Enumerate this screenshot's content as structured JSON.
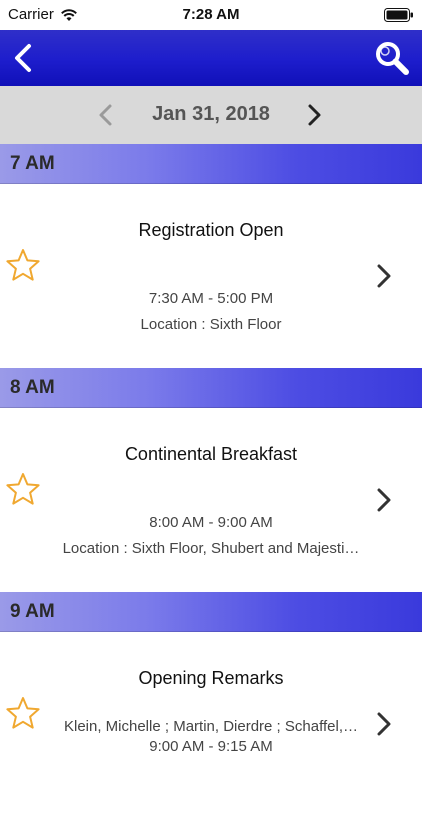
{
  "status_bar": {
    "carrier": "Carrier",
    "time": "7:28 AM",
    "wifi_icon": "wifi-icon",
    "battery_icon": "battery-icon"
  },
  "nav": {
    "back_icon": "chevron-left-icon",
    "search_icon": "search-icon",
    "bar_color": "#1d1dcc"
  },
  "date_bar": {
    "date": "Jan 31, 2018",
    "prev_icon": "chevron-left-icon",
    "next_icon": "chevron-right-icon"
  },
  "schedule": [
    {
      "hour": "7 AM",
      "session": {
        "title": "Registration Open",
        "speakers": "",
        "time": "7:30 AM - 5:00 PM",
        "location": "Location : Sixth Floor"
      }
    },
    {
      "hour": "8 AM",
      "session": {
        "title": "Continental Breakfast",
        "speakers": "",
        "time": "8:00 AM - 9:00 AM",
        "location": "Location : Sixth Floor, Shubert and Majesti…"
      }
    },
    {
      "hour": "9 AM",
      "session": {
        "title": "Opening Remarks",
        "speakers": "Klein, Michelle ; Martin, Dierdre ; Schaffel,…",
        "time": "9:00 AM - 9:15 AM",
        "location": ""
      }
    }
  ],
  "colors": {
    "star": "#f0a830",
    "hour_header": "#4d4de3",
    "date_bar": "#d9d9d9"
  }
}
